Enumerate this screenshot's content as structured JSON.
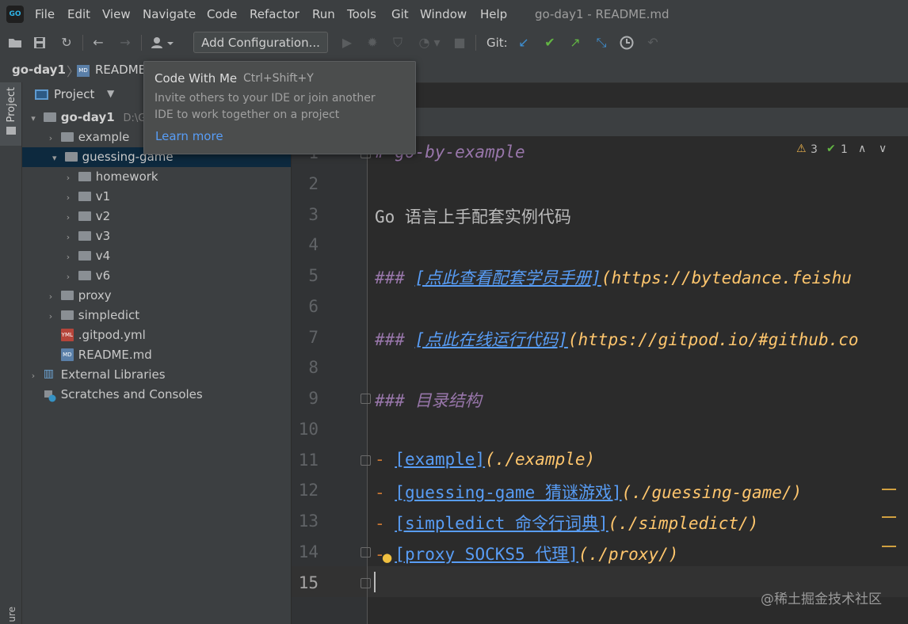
{
  "menu": {
    "items": [
      "File",
      "Edit",
      "View",
      "Navigate",
      "Code",
      "Refactor",
      "Run",
      "Tools",
      "Git",
      "Window",
      "Help"
    ],
    "window_title": "go-day1 - README.md",
    "logo": "GO"
  },
  "toolbar": {
    "add_configuration": "Add Configuration...",
    "git_label": "Git:"
  },
  "navbar": {
    "project": "go-day1",
    "file": "README",
    "file_icon": "MD"
  },
  "tool_window": {
    "stripe_label": "Project",
    "header_title": "Project",
    "bottom_stripe_label": "ure"
  },
  "tree": {
    "root_name": "go-day1",
    "root_path": "D:\\G",
    "items": [
      {
        "name": "example"
      },
      {
        "name": "guessing-game"
      },
      {
        "name": "homework"
      },
      {
        "name": "v1"
      },
      {
        "name": "v2"
      },
      {
        "name": "v3"
      },
      {
        "name": "v4"
      },
      {
        "name": "v6"
      },
      {
        "name": "proxy"
      },
      {
        "name": "simpledict"
      },
      {
        "name": ".gitpod.yml",
        "icon_label": "YML"
      },
      {
        "name": "README.md",
        "icon_label": "MD"
      },
      {
        "name": "External Libraries"
      },
      {
        "name": "Scratches and Consoles"
      }
    ]
  },
  "editor": {
    "warnings_count": "3",
    "ok_count": "1",
    "line_numbers": [
      "1",
      "2",
      "3",
      "4",
      "5",
      "6",
      "7",
      "8",
      "9",
      "10",
      "11",
      "12",
      "13",
      "14",
      "15"
    ],
    "lines": {
      "l1": "# go-by-example",
      "l3": "Go 语言上手配套实例代码",
      "l5_hash": "### ",
      "l5_text": "[点此查看配套学员手册]",
      "l5_url": "(https://bytedance.feishu",
      "l7_hash": "### ",
      "l7_text": "[点此在线运行代码]",
      "l7_url": "(https://gitpod.io/#github.co",
      "l9": "### 目录结构",
      "l11_dash": "- ",
      "l11_text": "[example]",
      "l11_url": "(./example)",
      "l12_dash": "- ",
      "l12_text": "[guessing-game 猜谜游戏]",
      "l12_url": "(./guessing-game/)",
      "l13_dash": "- ",
      "l13_text": "[simpledict 命令行词典]",
      "l13_url": "(./simpledict/)",
      "l14_dash": "- ",
      "l14_text": "[proxy SOCKS5 代理]",
      "l14_url": "(./proxy/)"
    }
  },
  "tooltip": {
    "title": "Code With Me",
    "shortcut": "Ctrl+Shift+Y",
    "description_line1": "Invite others to your IDE or join another",
    "description_line2": "IDE to work together on a project",
    "link": "Learn more"
  },
  "watermark": "@稀土掘金技术社区",
  "colors": {
    "accent_blue": "#589df6",
    "heading_purple": "#9876aa",
    "url_orange": "#ffc66d",
    "git_green": "#62b543",
    "selection": "#0d293e"
  }
}
